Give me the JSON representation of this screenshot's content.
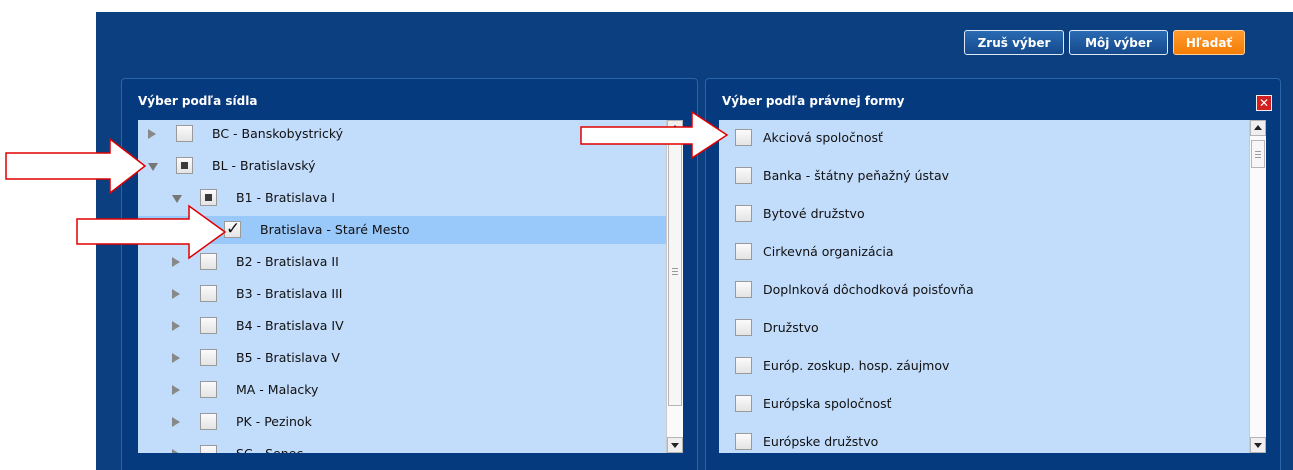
{
  "header": {
    "buttons": {
      "clear": "Zruš výber",
      "my_selection": "Môj výber",
      "search": "Hľadať"
    }
  },
  "seat_panel": {
    "title": "Výber podľa sídla",
    "items": [
      {
        "label": "BC - Banskobystrický",
        "state": "unchecked",
        "expander": "collapsed"
      },
      {
        "label": "BL - Bratislavský",
        "state": "partial",
        "expander": "expanded"
      },
      {
        "label": "B1 - Bratislava I",
        "state": "partial",
        "expander": "expanded"
      },
      {
        "label": "Bratislava - Staré Mesto",
        "state": "checked",
        "expander": "none",
        "selected": true
      },
      {
        "label": "B2 - Bratislava II",
        "state": "unchecked",
        "expander": "collapsed"
      },
      {
        "label": "B3 - Bratislava III",
        "state": "unchecked",
        "expander": "collapsed"
      },
      {
        "label": "B4 - Bratislava IV",
        "state": "unchecked",
        "expander": "collapsed"
      },
      {
        "label": "B5 - Bratislava V",
        "state": "unchecked",
        "expander": "collapsed"
      },
      {
        "label": "MA - Malacky",
        "state": "unchecked",
        "expander": "collapsed"
      },
      {
        "label": "PK - Pezinok",
        "state": "unchecked",
        "expander": "collapsed"
      },
      {
        "label": "SC - Senec",
        "state": "unchecked",
        "expander": "collapsed"
      }
    ]
  },
  "legal_form_panel": {
    "title": "Výber podľa právnej formy",
    "close_icon": "close-icon",
    "items": [
      "Akciová spoločnosť",
      "Banka - štátny peňažný ústav",
      "Bytové družstvo",
      "Cirkevná organizácia",
      "Doplnková dôchodková poisťovňa",
      "Družstvo",
      "Európ. zoskup. hosp. záujmov",
      "Európska spoločnosť",
      "Európske družstvo"
    ]
  },
  "colors": {
    "frame": "#0b3f80",
    "panel": "#063a7e",
    "list_bg": "#c2dcfb",
    "selected_row": "#99c8fb",
    "search_button": "#f47d05",
    "annotation_arrows": "#e00000"
  }
}
